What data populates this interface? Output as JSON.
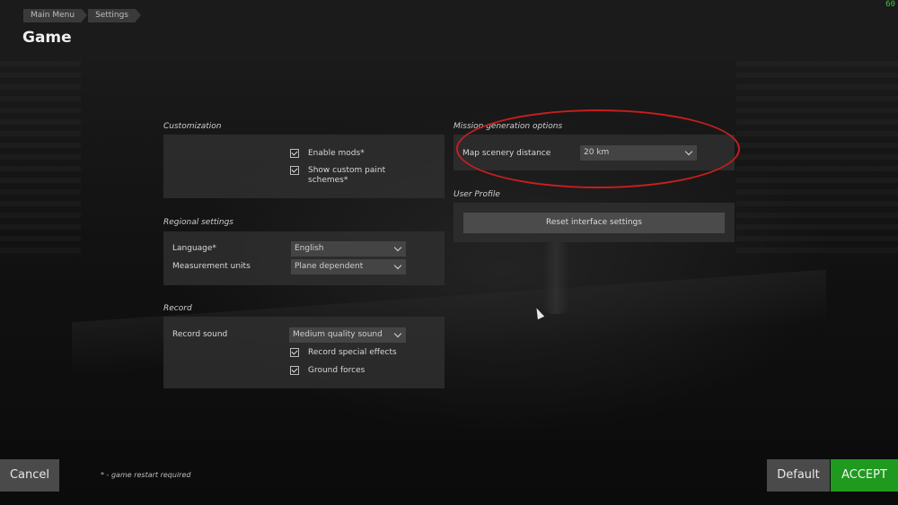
{
  "header": {
    "breadcrumb": [
      "Main Menu",
      "Settings"
    ],
    "title": "Game",
    "fps": "60"
  },
  "customization": {
    "title": "Customization",
    "enable_mods": {
      "label": "Enable mods*",
      "checked": true
    },
    "custom_paint": {
      "label_line1": "Show custom paint",
      "label_line2": "schemes*",
      "checked": true
    }
  },
  "regional": {
    "title": "Regional settings",
    "language": {
      "label": "Language*",
      "value": "English"
    },
    "measurement": {
      "label": "Measurement units",
      "value": "Plane dependent"
    }
  },
  "record": {
    "title": "Record",
    "sound": {
      "label": "Record sound",
      "value": "Medium quality sound"
    },
    "special_effects": {
      "label": "Record special effects",
      "checked": true
    },
    "ground_forces": {
      "label": "Ground forces",
      "checked": true
    }
  },
  "mission": {
    "title": "Mission generation options",
    "scenery_distance": {
      "label": "Map scenery distance",
      "value": "20 km"
    }
  },
  "user_profile": {
    "title": "User Profile",
    "reset_label": "Reset interface settings"
  },
  "footer": {
    "cancel": "Cancel",
    "note": "* - game restart required",
    "default": "Default",
    "accept": "ACCEPT"
  },
  "colors": {
    "accept": "#1f9a1f",
    "highlight": "#c81e1e"
  }
}
